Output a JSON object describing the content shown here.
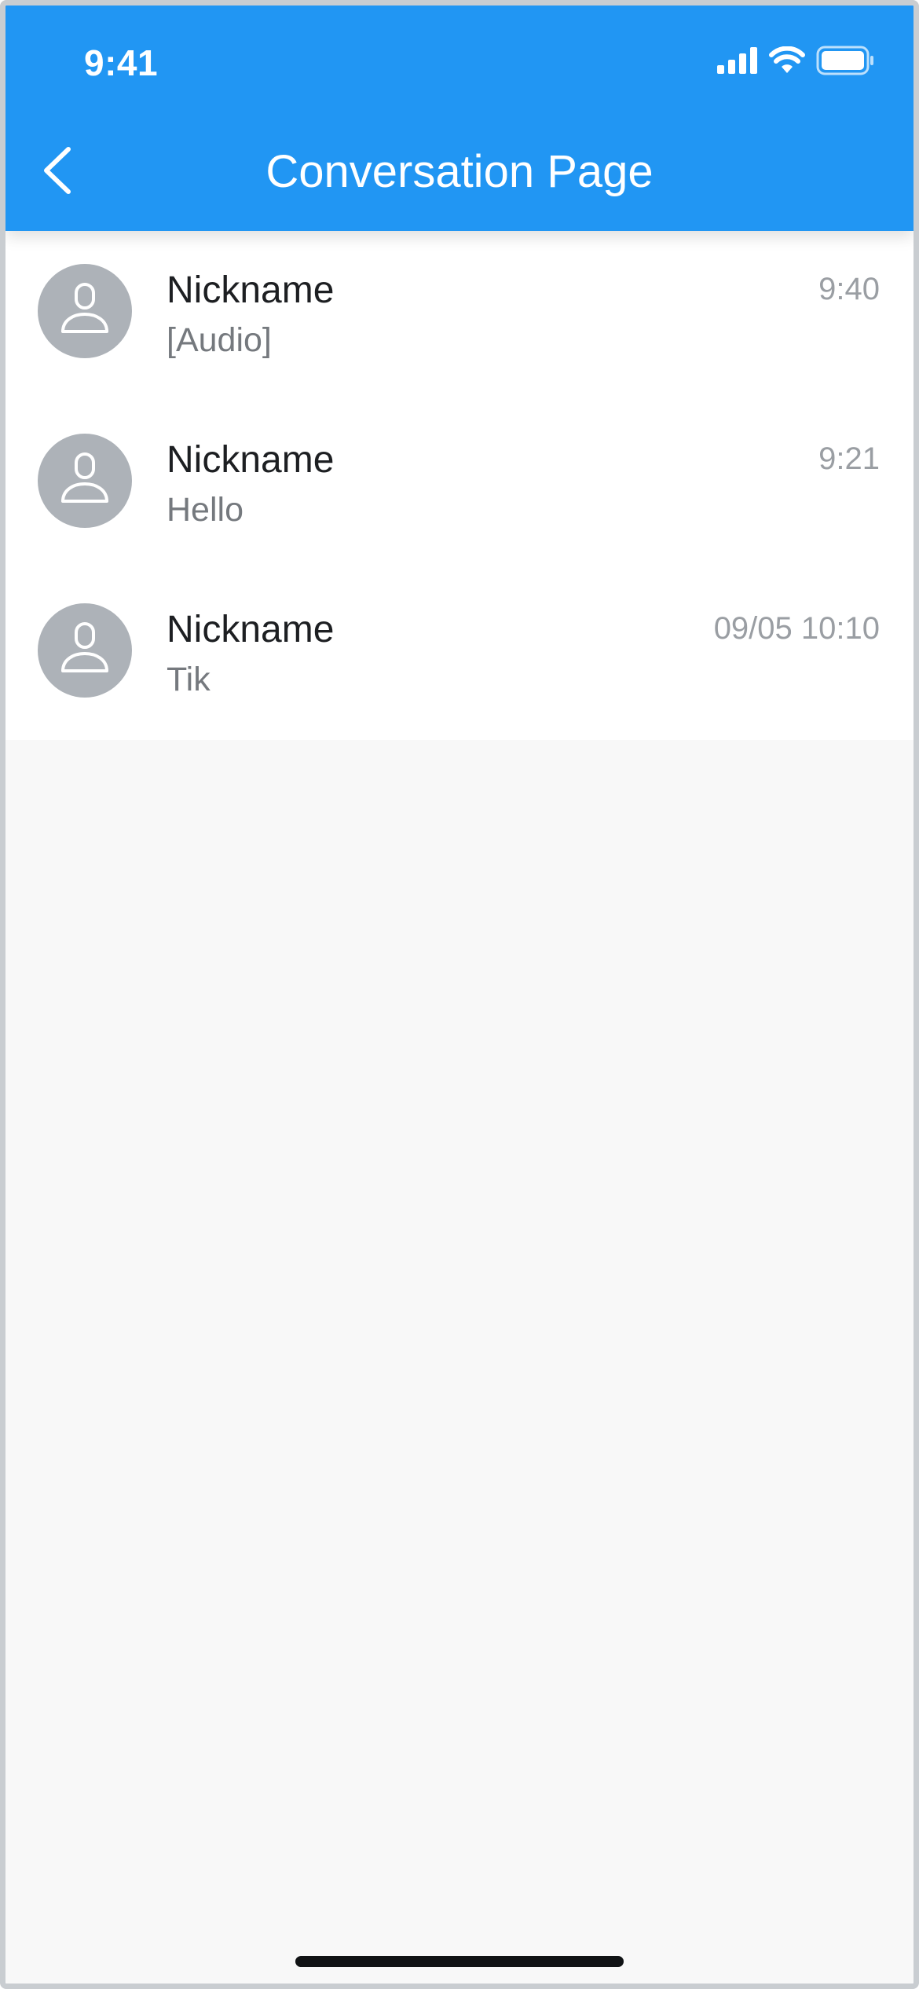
{
  "status_bar": {
    "time": "9:41",
    "signal_icon": "cellular-signal-icon",
    "wifi_icon": "wifi-icon",
    "battery_icon": "battery-icon"
  },
  "header": {
    "back_icon": "chevron-left-icon",
    "title": "Conversation Page",
    "color": "#2196f3"
  },
  "conversations": [
    {
      "nickname": "Nickname",
      "preview": "[Audio]",
      "time": "9:40",
      "avatar_icon": "user-icon"
    },
    {
      "nickname": "Nickname",
      "preview": "Hello",
      "time": "9:21",
      "avatar_icon": "user-icon"
    },
    {
      "nickname": "Nickname",
      "preview": "Tik",
      "time": "09/05 10:10",
      "avatar_icon": "user-icon"
    }
  ]
}
